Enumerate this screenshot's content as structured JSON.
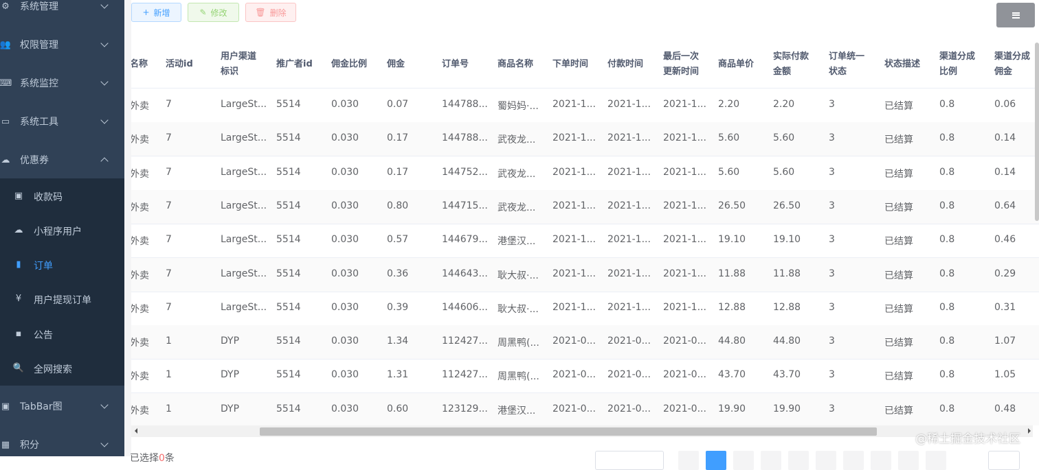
{
  "sidebar": {
    "menus": [
      {
        "label": "系统管理",
        "icon": "gear-icon",
        "glyph": "⚙",
        "expanded": false
      },
      {
        "label": "权限管理",
        "icon": "users-icon",
        "glyph": "👥",
        "expanded": false
      },
      {
        "label": "系统监控",
        "icon": "monitor-icon",
        "glyph": "⌨",
        "expanded": false
      },
      {
        "label": "系统工具",
        "icon": "toolbox-icon",
        "glyph": "▭",
        "expanded": false
      },
      {
        "label": "优惠券",
        "icon": "coupon-icon",
        "glyph": "☁",
        "expanded": true
      },
      {
        "label": "TabBar图",
        "icon": "image-icon",
        "glyph": "▣",
        "expanded": false
      },
      {
        "label": "积分",
        "icon": "grid-icon",
        "glyph": "▦",
        "expanded": false
      }
    ],
    "submenu": [
      {
        "label": "收款码",
        "icon": "qrcode-icon",
        "glyph": "▣",
        "active": false
      },
      {
        "label": "小程序用户",
        "icon": "user-icon",
        "glyph": "☁",
        "active": false
      },
      {
        "label": "订单",
        "icon": "bar-chart-icon",
        "glyph": "▮",
        "active": true
      },
      {
        "label": "用户提现订单",
        "icon": "yen-icon",
        "glyph": "¥",
        "active": false
      },
      {
        "label": "公告",
        "icon": "message-icon",
        "glyph": "▪",
        "active": false
      },
      {
        "label": "全网搜索",
        "icon": "search-icon",
        "glyph": "🔍",
        "active": false
      }
    ]
  },
  "toolbar": {
    "add_label": "新增",
    "add_icon": "+",
    "edit_label": "修改",
    "edit_icon": "✎",
    "delete_label": "删除",
    "delete_icon": "🗑"
  },
  "table": {
    "headers": [
      [
        "名称"
      ],
      [
        "活动id"
      ],
      [
        "用户渠道",
        "标识"
      ],
      [
        "推广者id"
      ],
      [
        "佣金比例"
      ],
      [
        "佣金"
      ],
      [
        "订单号"
      ],
      [
        "商品名称"
      ],
      [
        "下单时间"
      ],
      [
        "付款时间"
      ],
      [
        "最后一次",
        "更新时间"
      ],
      [
        "商品单价"
      ],
      [
        "实际付款",
        "金额"
      ],
      [
        "订单统一",
        "状态"
      ],
      [
        "状态描述"
      ],
      [
        "渠道分成",
        "比例"
      ],
      [
        "渠道分成",
        "佣金"
      ]
    ],
    "rows": [
      [
        "外卖",
        "7",
        "LargeSt...",
        "5514",
        "0.030",
        "0.07",
        "144788...",
        "蜀妈妈·...",
        "2021-1...",
        "2021-1...",
        "2021-1...",
        "2.20",
        "2.20",
        "3",
        "已结算",
        "0.8",
        "0.06"
      ],
      [
        "外卖",
        "7",
        "LargeSt...",
        "5514",
        "0.030",
        "0.17",
        "144788...",
        "武夜龙...",
        "2021-1...",
        "2021-1...",
        "2021-1...",
        "5.60",
        "5.60",
        "3",
        "已结算",
        "0.8",
        "0.14"
      ],
      [
        "外卖",
        "7",
        "LargeSt...",
        "5514",
        "0.030",
        "0.17",
        "144752...",
        "武夜龙...",
        "2021-1...",
        "2021-1...",
        "2021-1...",
        "5.60",
        "5.60",
        "3",
        "已结算",
        "0.8",
        "0.14"
      ],
      [
        "外卖",
        "7",
        "LargeSt...",
        "5514",
        "0.030",
        "0.80",
        "144715...",
        "武夜龙...",
        "2021-1...",
        "2021-1...",
        "2021-1...",
        "26.50",
        "26.50",
        "3",
        "已结算",
        "0.8",
        "0.64"
      ],
      [
        "外卖",
        "7",
        "LargeSt...",
        "5514",
        "0.030",
        "0.57",
        "144679...",
        "港堡汉...",
        "2021-1...",
        "2021-1...",
        "2021-1...",
        "19.10",
        "19.10",
        "3",
        "已结算",
        "0.8",
        "0.46"
      ],
      [
        "外卖",
        "7",
        "LargeSt...",
        "5514",
        "0.030",
        "0.36",
        "144643...",
        "耿大叔·...",
        "2021-1...",
        "2021-1...",
        "2021-1...",
        "11.88",
        "11.88",
        "3",
        "已结算",
        "0.8",
        "0.29"
      ],
      [
        "外卖",
        "7",
        "LargeSt...",
        "5514",
        "0.030",
        "0.39",
        "144606...",
        "耿大叔·...",
        "2021-1...",
        "2021-1...",
        "2021-1...",
        "12.88",
        "12.88",
        "3",
        "已结算",
        "0.8",
        "0.31"
      ],
      [
        "外卖",
        "1",
        "DYP",
        "5514",
        "0.030",
        "1.34",
        "112427...",
        "周黑鸭(...",
        "2021-0...",
        "2021-0...",
        "2021-0...",
        "44.80",
        "44.80",
        "3",
        "已结算",
        "0.8",
        "1.07"
      ],
      [
        "外卖",
        "1",
        "DYP",
        "5514",
        "0.030",
        "1.31",
        "112427...",
        "周黑鸭(...",
        "2021-0...",
        "2021-0...",
        "2021-0...",
        "43.70",
        "43.70",
        "3",
        "已结算",
        "0.8",
        "1.05"
      ],
      [
        "外卖",
        "1",
        "DYP",
        "5514",
        "0.030",
        "0.60",
        "123129...",
        "港堡汉...",
        "2021-0...",
        "2021-0...",
        "2021-0...",
        "19.90",
        "19.90",
        "3",
        "已结算",
        "0.8",
        "0.48"
      ]
    ]
  },
  "footer": {
    "prefix": "已选择",
    "count": "0",
    "suffix": "条"
  },
  "watermark": "@稀土掘金技术社区"
}
